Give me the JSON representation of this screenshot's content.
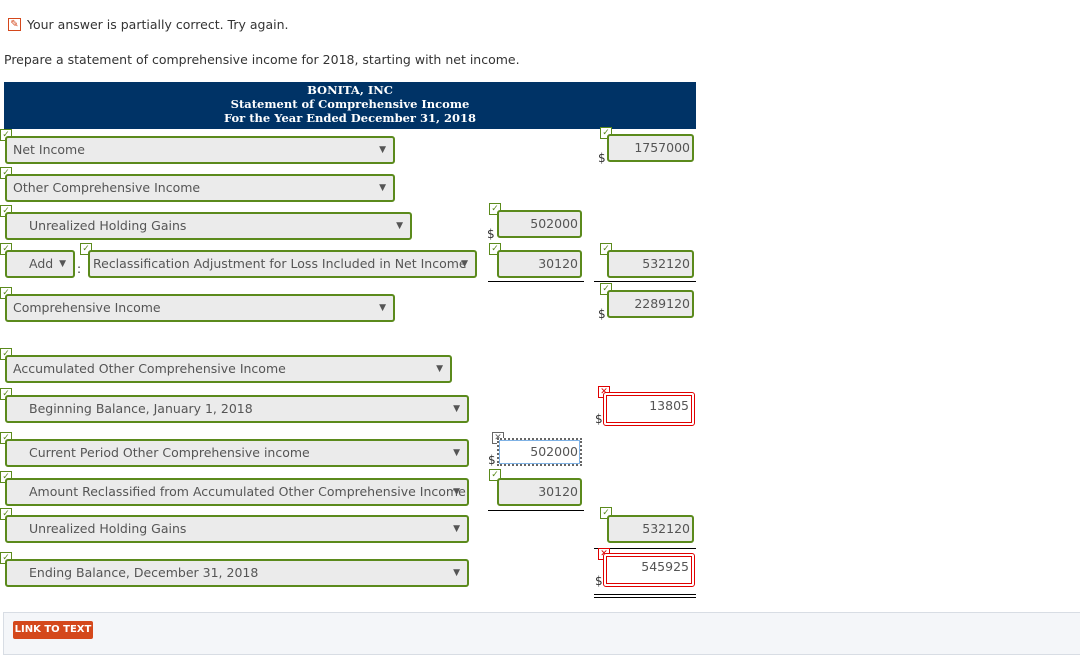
{
  "feedback": {
    "icon": "pencil-icon",
    "text": "Your answer is partially correct.  Try again."
  },
  "instructions": "Prepare a statement of comprehensive income for 2018, starting with net income.",
  "header": {
    "company": "BONITA, INC",
    "statement": "Statement of Comprehensive Income",
    "period": "For the Year Ended December 31, 2018"
  },
  "rows": {
    "net_income": {
      "label": "Net Income",
      "amount": "1757000"
    },
    "oci": {
      "label": "Other Comprehensive Income"
    },
    "unrealized": {
      "label": "Unrealized Holding Gains",
      "amount": "502000"
    },
    "reclass": {
      "op": "Add",
      "colon": ":",
      "label": "Reclassification Adjustment for Loss Included in Net Income",
      "amount": "30120",
      "total": "532120"
    },
    "comprehensive": {
      "label": "Comprehensive Income",
      "amount": "2289120"
    },
    "aoci": {
      "label": "Accumulated Other Comprehensive Income"
    },
    "beginning": {
      "label": "Beginning Balance, January 1, 2018",
      "amount": "13805"
    },
    "current": {
      "label": "Current Period Other Comprehensive income",
      "amount": "502000"
    },
    "reclassified": {
      "label": "Amount Reclassified from Accumulated Other Comprehensive Income",
      "amount": "30120"
    },
    "unrealized2": {
      "label": "Unrealized Holding Gains",
      "amount": "532120"
    },
    "ending": {
      "label": "Ending Balance, December 31, 2018",
      "amount": "545925"
    }
  },
  "currency": "$",
  "footer": {
    "link_to_text": "LINK TO TEXT"
  },
  "colors": {
    "header_bg": "#003366",
    "correct": "#5b8a1c",
    "incorrect": "#e00000",
    "button": "#d4481c"
  }
}
